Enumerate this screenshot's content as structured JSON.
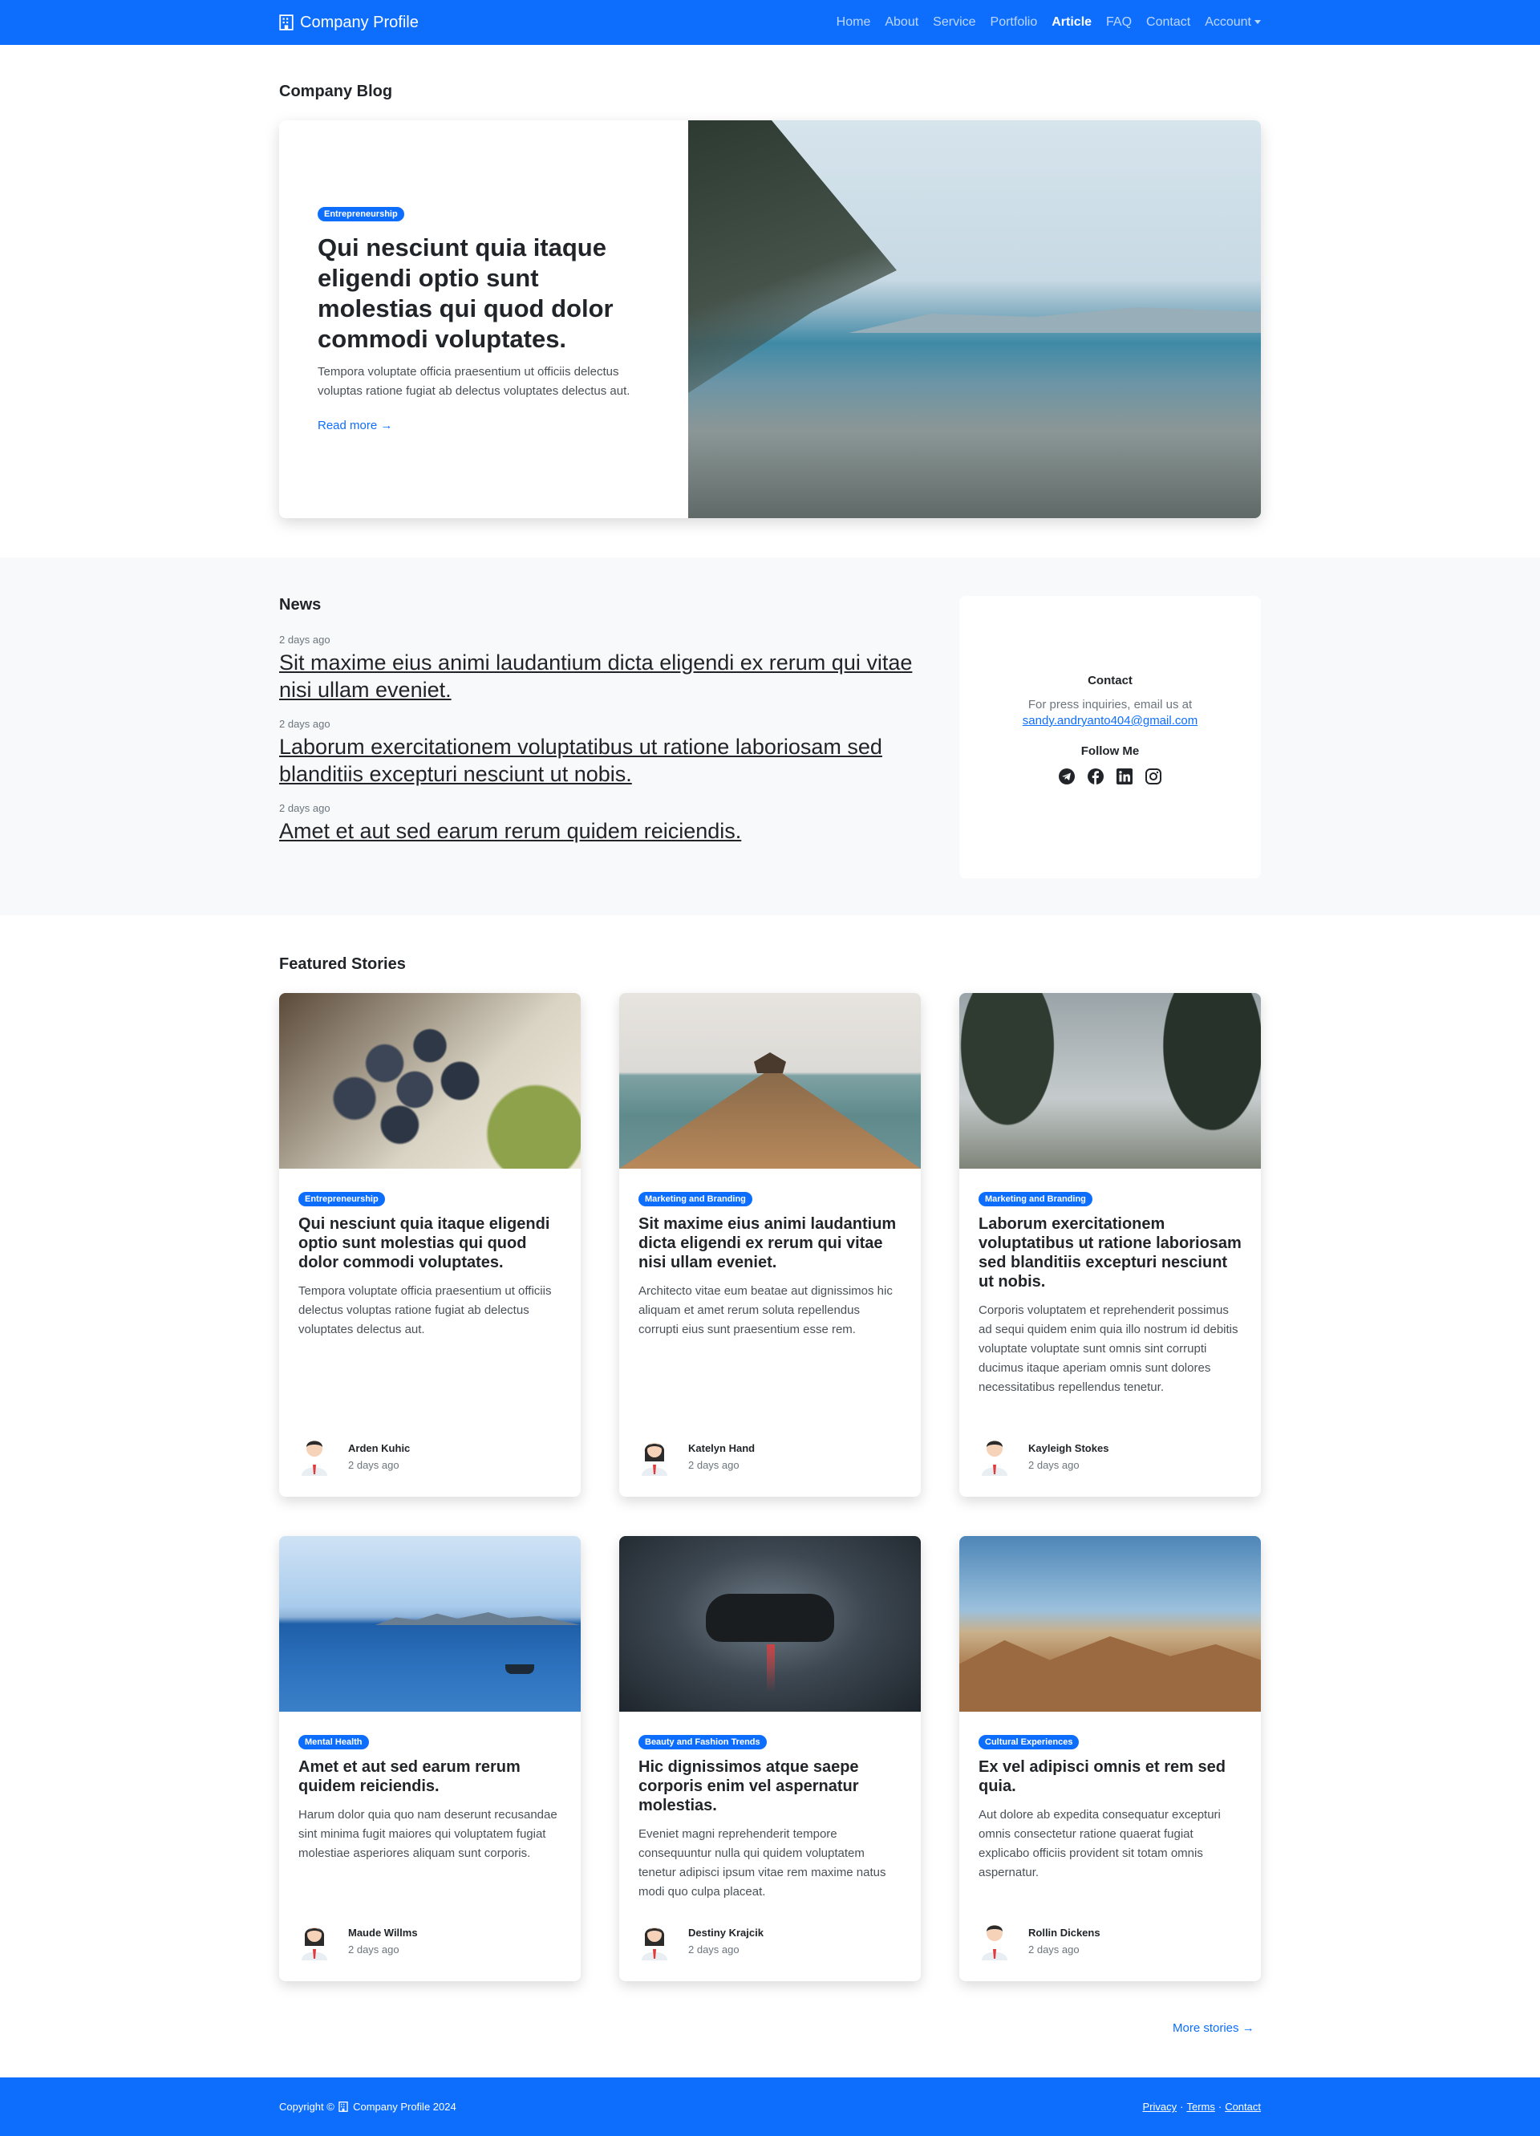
{
  "navbar": {
    "brand": "Company Profile",
    "links": [
      "Home",
      "About",
      "Service",
      "Portfolio",
      "Article",
      "FAQ",
      "Contact",
      "Account"
    ],
    "active": "Article",
    "bg_color": "#0d6efd"
  },
  "blog": {
    "section_title": "Company Blog",
    "hero": {
      "badge": "Entrepreneurship",
      "title": "Qui nesciunt quia itaque eligendi optio sunt molestias qui quod dolor commodi voluptates.",
      "excerpt": "Tempora voluptate officia praesentium ut officiis delectus voluptas ratione fugiat ab delectus voluptates delectus aut.",
      "read_more": "Read more →"
    }
  },
  "news": {
    "section_title": "News",
    "items": [
      {
        "date": "2 days ago",
        "title": "Sit maxime eius animi laudantium dicta eligendi ex rerum qui vitae nisi ullam eveniet."
      },
      {
        "date": "2 days ago",
        "title": "Laborum exercitationem voluptatibus ut ratione laboriosam sed blanditiis excepturi nesciunt ut nobis."
      },
      {
        "date": "2 days ago",
        "title": "Amet et aut sed earum rerum quidem reiciendis."
      }
    ],
    "contact": {
      "title": "Contact",
      "text": "For press inquiries, email us at",
      "email": "sandy.andryanto404@gmail.com",
      "follow_title": "Follow Me",
      "socials": [
        "telegram-icon",
        "facebook-icon",
        "linkedin-icon",
        "instagram-icon"
      ]
    }
  },
  "featured": {
    "section_title": "Featured Stories",
    "cards": [
      {
        "badge": "Entrepreneurship",
        "title": "Qui nesciunt quia itaque eligendi optio sunt molestias qui quod dolor commodi voluptates.",
        "excerpt": "Tempora voluptate officia praesentium ut officiis delectus voluptas ratione fugiat ab delectus voluptates delectus aut.",
        "author": "Arden Kuhic",
        "date": "2 days ago",
        "image": "grapes-photo",
        "avatar": "male"
      },
      {
        "badge": "Marketing and Branding",
        "title": "Sit maxime eius animi laudantium dicta eligendi ex rerum qui vitae nisi ullam eveniet.",
        "excerpt": "Architecto vitae eum beatae aut dignissimos hic aliquam et amet rerum soluta repellendus corrupti eius sunt praesentium esse rem.",
        "author": "Katelyn Hand",
        "date": "2 days ago",
        "image": "pier-photo",
        "avatar": "female"
      },
      {
        "badge": "Marketing and Branding",
        "title": "Laborum exercitationem voluptatibus ut ratione laboriosam sed blanditiis excepturi nesciunt ut nobis.",
        "excerpt": "Corporis voluptatem et reprehenderit possimus ad sequi quidem enim quia illo nostrum id debitis voluptate voluptate sunt omnis sint corrupti ducimus itaque aperiam omnis sunt dolores necessitatibus repellendus tenetur.",
        "author": "Kayleigh Stokes",
        "date": "2 days ago",
        "image": "trees-photo",
        "avatar": "male"
      },
      {
        "badge": "Mental Health",
        "title": "Amet et aut sed earum rerum quidem reiciendis.",
        "excerpt": "Harum dolor quia quo nam deserunt recusandae sint minima fugit maiores qui voluptatem fugiat molestiae asperiores aliquam sunt corporis.",
        "author": "Maude Willms",
        "date": "2 days ago",
        "image": "bay-photo",
        "avatar": "female"
      },
      {
        "badge": "Beauty and Fashion Trends",
        "title": "Hic dignissimos atque saepe corporis enim vel aspernatur molestias.",
        "excerpt": "Eveniet magni reprehenderit tempore consequuntur nulla qui quidem voluptatem tenetur adipisci ipsum vitae rem maxime natus modi quo culpa placeat.",
        "author": "Destiny Krajcik",
        "date": "2 days ago",
        "image": "controller-photo",
        "avatar": "female"
      },
      {
        "badge": "Cultural Experiences",
        "title": "Ex vel adipisci omnis et rem sed quia.",
        "excerpt": "Aut dolore ab expedita consequatur excepturi omnis consectetur ratione quaerat fugiat explicabo officiis provident sit totam omnis aspernatur.",
        "author": "Rollin Dickens",
        "date": "2 days ago",
        "image": "desert-photo",
        "avatar": "male"
      }
    ],
    "more_stories": "More stories →"
  },
  "footer": {
    "copyright_prefix": "Copyright ©",
    "copyright_brand": "Company Profile 2024",
    "links": [
      "Privacy",
      "Terms",
      "Contact"
    ],
    "separator": "·"
  }
}
